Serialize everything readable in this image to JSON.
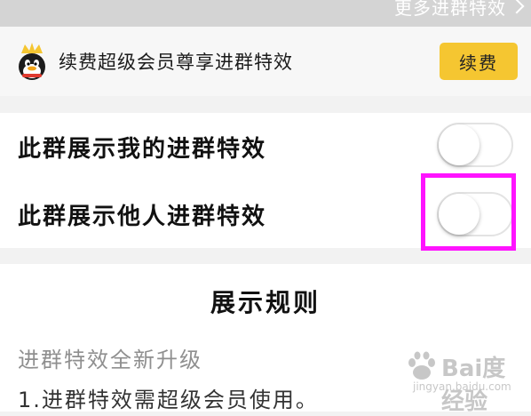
{
  "header": {
    "more_link": "更多进群特效"
  },
  "vip_banner": {
    "text": "续费超级会员尊享进群特效",
    "renew_button": "续费",
    "accent_color": "#f5c631"
  },
  "settings": {
    "items": [
      {
        "label": "此群展示我的进群特效",
        "enabled": false
      },
      {
        "label": "此群展示他人进群特效",
        "enabled": false
      }
    ],
    "highlight_color": "#ff14ff"
  },
  "rules": {
    "title": "展示规则",
    "subtitle": "进群特效全新升级",
    "item_1": "1.进群特效需超级会员使用。"
  },
  "watermark": {
    "brand": "Bai度经验",
    "url": "jingyan.baidu.com"
  }
}
